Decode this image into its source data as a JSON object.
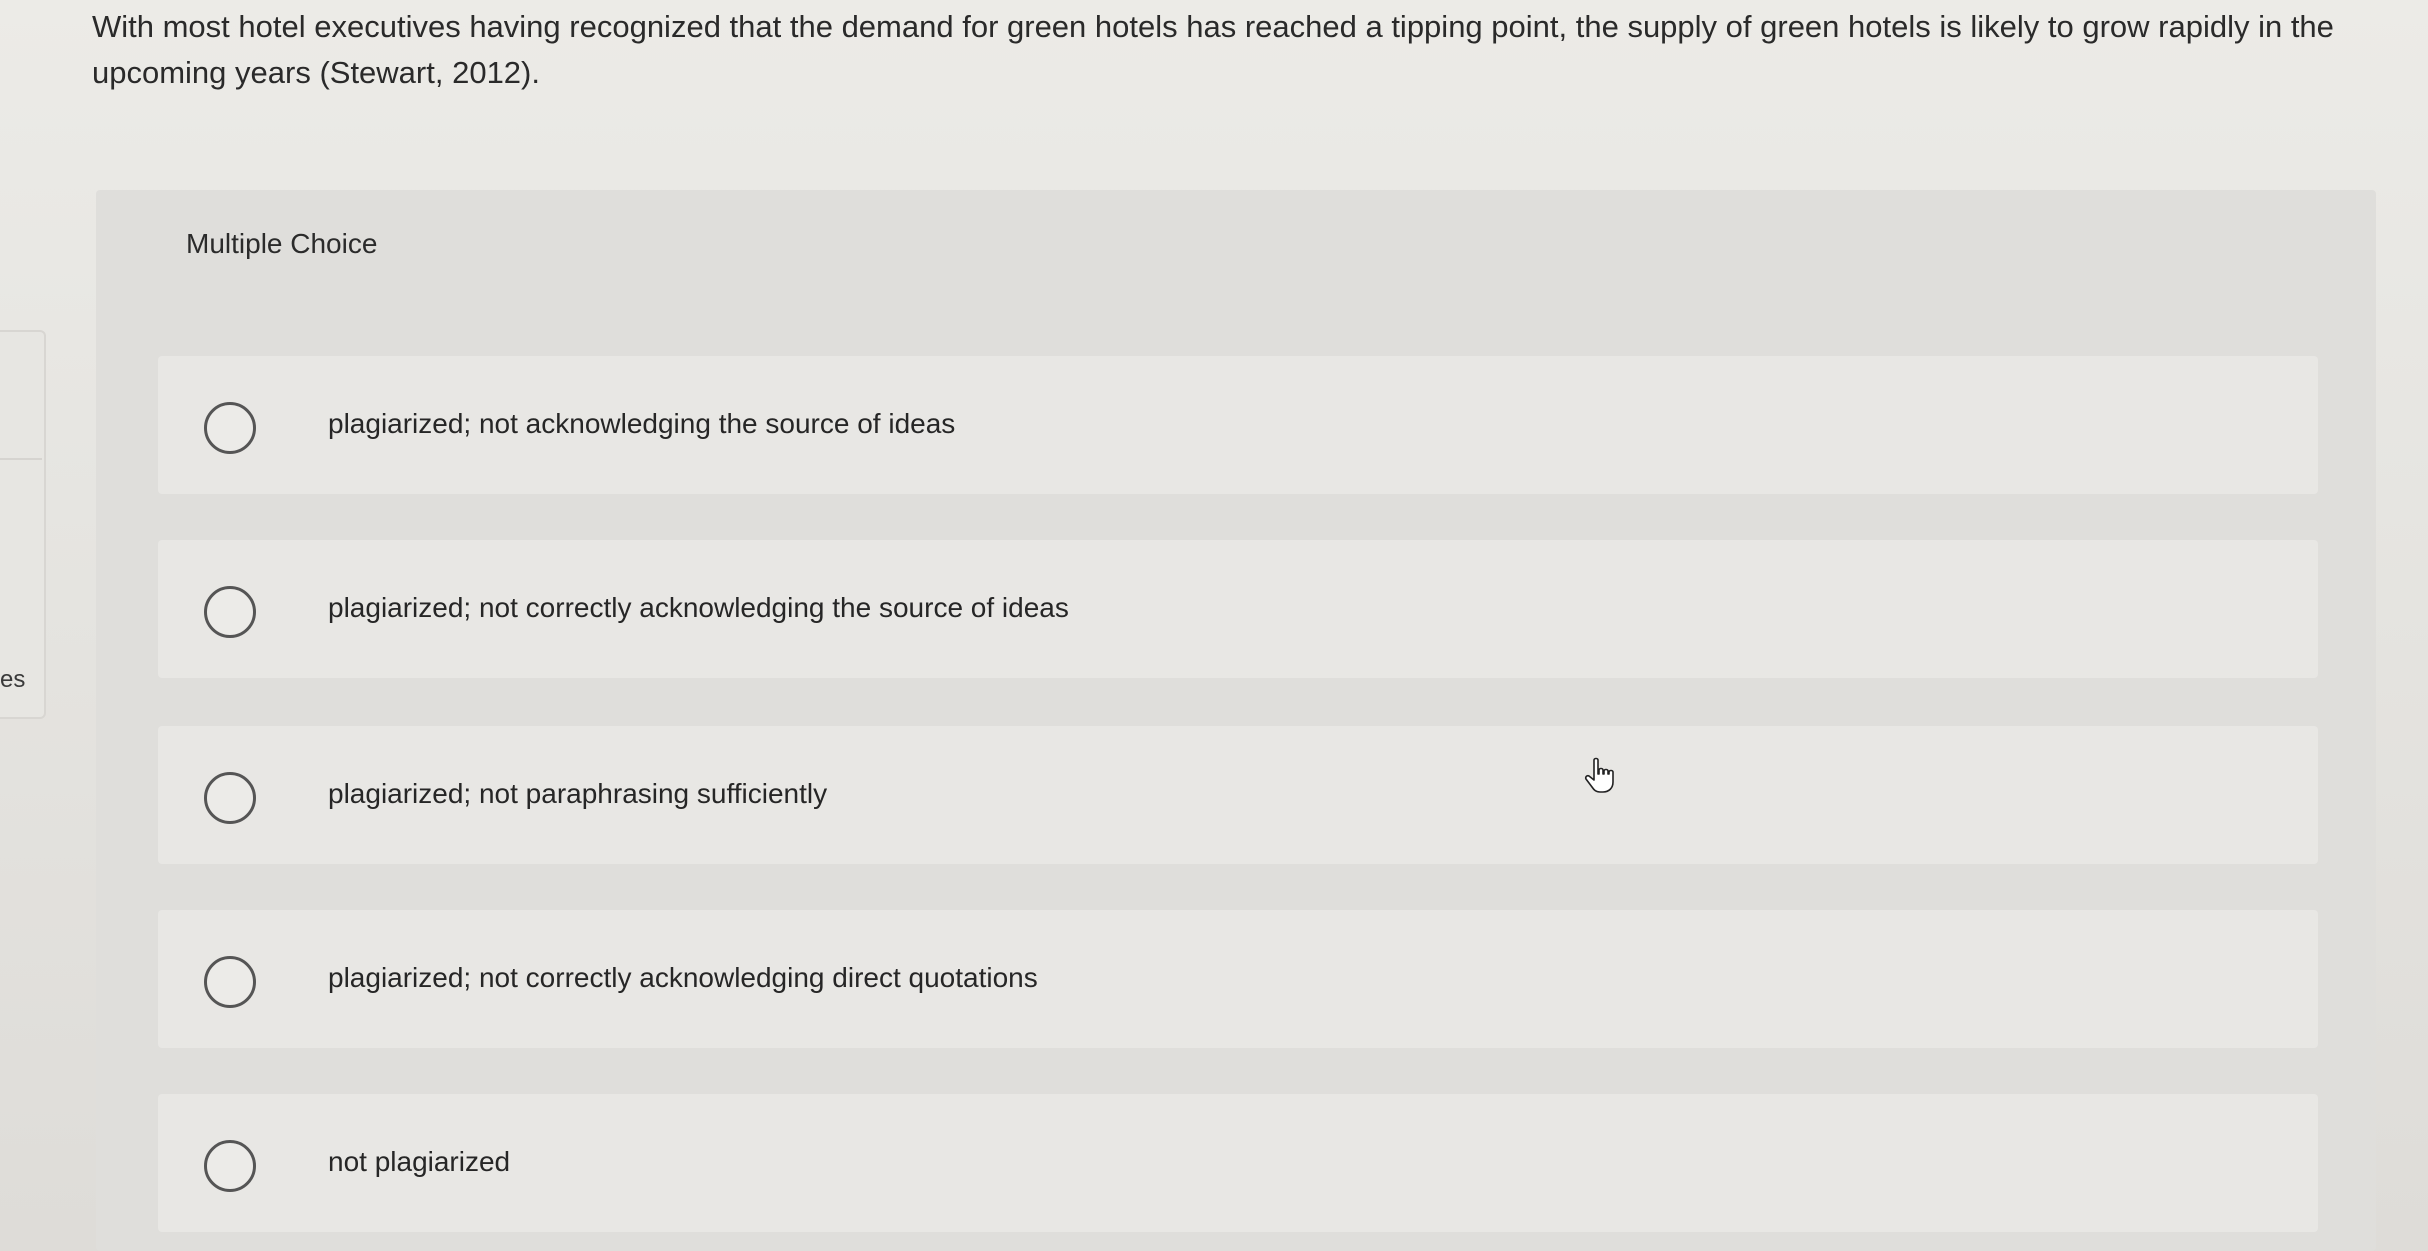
{
  "question": {
    "text": "With most hotel executives having recognized that the demand for green hotels has reached a tipping point, the supply of green hotels is likely to grow rapidly in the upcoming years (Stewart, 2012)."
  },
  "left_rail": {
    "label": "es"
  },
  "multiple_choice": {
    "label": "Multiple Choice",
    "options": [
      {
        "label": "plagiarized; not acknowledging the source of ideas",
        "selected": false
      },
      {
        "label": "plagiarized; not correctly acknowledging the source of ideas",
        "selected": false
      },
      {
        "label": "plagiarized; not paraphrasing sufficiently",
        "selected": false
      },
      {
        "label": "plagiarized; not correctly acknowledging direct quotations",
        "selected": false
      },
      {
        "label": "not plagiarized",
        "selected": false
      }
    ]
  },
  "cursor": {
    "icon": "hand-pointer-icon"
  },
  "colors": {
    "background": "#e9e8e4",
    "panel": "#dfdedb",
    "option_bg": "#e8e7e4",
    "radio_border": "#555555",
    "text": "#2a2a2a"
  }
}
